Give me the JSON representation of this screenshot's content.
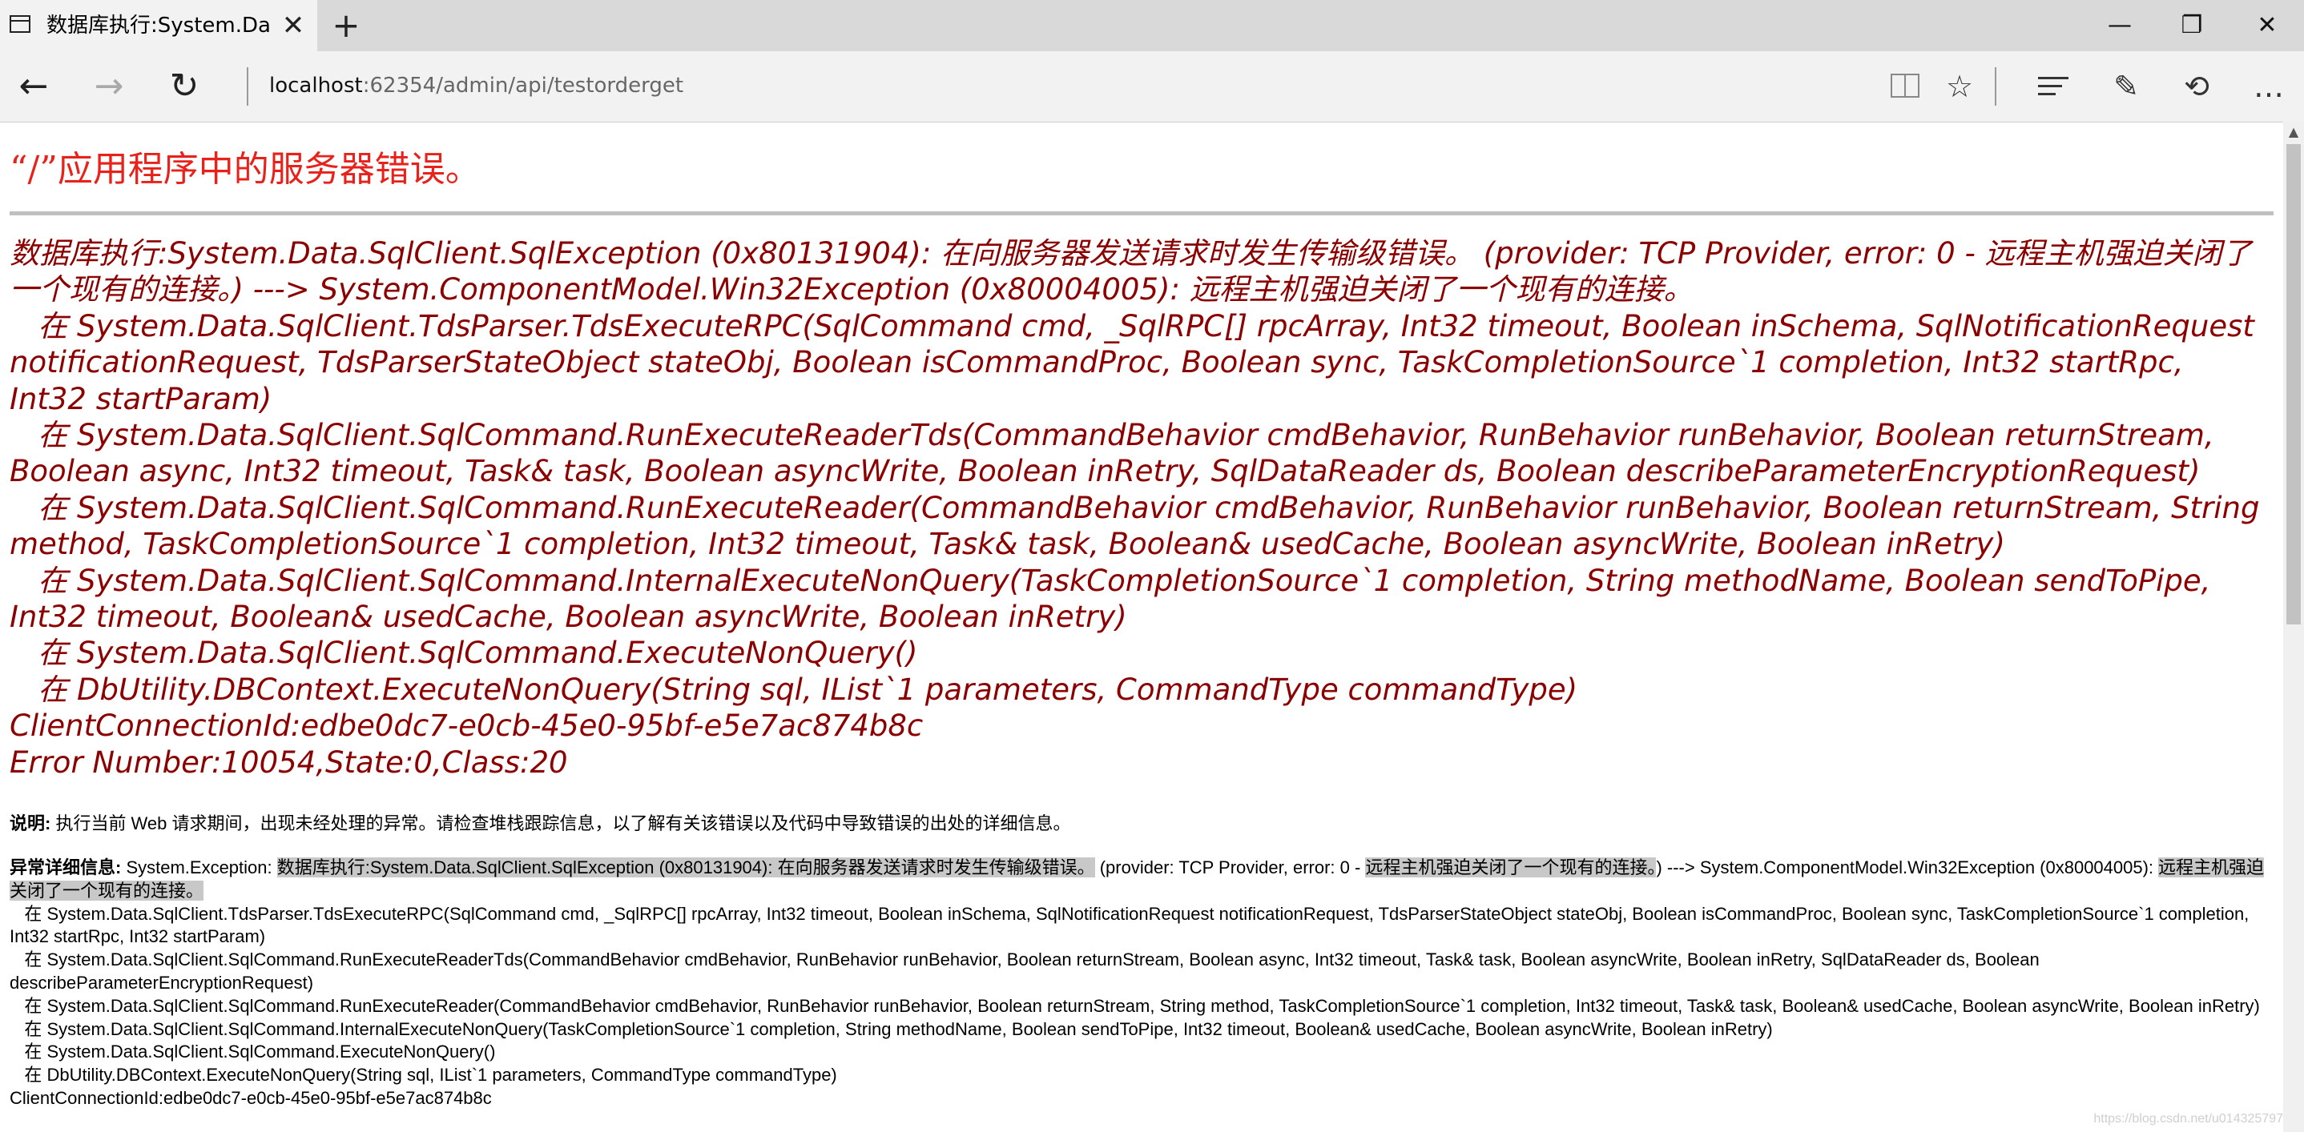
{
  "browser": {
    "tab_title": "数据库执行:System.Data",
    "tab_close": "✕",
    "new_tab": "+",
    "window": {
      "minimize": "—",
      "maximize": "❐",
      "close": "✕"
    },
    "address": {
      "host": "localhost",
      "rest": ":62354/admin/api/testorderget"
    },
    "nav": {
      "back": "←",
      "forward": "→",
      "refresh": "↻"
    },
    "tools": {
      "favorite": "☆",
      "share": "⟲",
      "more": "…",
      "note": "✎"
    }
  },
  "page": {
    "heading": "“/”应用程序中的服务器错误。",
    "error_message": "数据库执行:System.Data.SqlClient.SqlException (0x80131904): 在向服务器发送请求时发生传输级错误。 (provider: TCP Provider, error: 0 - 远程主机强迫关闭了一个现有的连接。) ---> System.ComponentModel.Win32Exception (0x80004005): 远程主机强迫关闭了一个现有的连接。\n   在 System.Data.SqlClient.TdsParser.TdsExecuteRPC(SqlCommand cmd, _SqlRPC[] rpcArray, Int32 timeout, Boolean inSchema, SqlNotificationRequest notificationRequest, TdsParserStateObject stateObj, Boolean isCommandProc, Boolean sync, TaskCompletionSource`1 completion, Int32 startRpc, Int32 startParam)\n   在 System.Data.SqlClient.SqlCommand.RunExecuteReaderTds(CommandBehavior cmdBehavior, RunBehavior runBehavior, Boolean returnStream, Boolean async, Int32 timeout, Task& task, Boolean asyncWrite, Boolean inRetry, SqlDataReader ds, Boolean describeParameterEncryptionRequest)\n   在 System.Data.SqlClient.SqlCommand.RunExecuteReader(CommandBehavior cmdBehavior, RunBehavior runBehavior, Boolean returnStream, String method, TaskCompletionSource`1 completion, Int32 timeout, Task& task, Boolean& usedCache, Boolean asyncWrite, Boolean inRetry)\n   在 System.Data.SqlClient.SqlCommand.InternalExecuteNonQuery(TaskCompletionSource`1 completion, String methodName, Boolean sendToPipe, Int32 timeout, Boolean& usedCache, Boolean asyncWrite, Boolean inRetry)\n   在 System.Data.SqlClient.SqlCommand.ExecuteNonQuery()\n   在 DbUtility.DBContext.ExecuteNonQuery(String sql, IList`1 parameters, CommandType commandType)\nClientConnectionId:edbe0dc7-e0cb-45e0-95bf-e5e7ac874b8c\nError Number:10054,State:0,Class:20",
    "description_label": "说明:",
    "description_text": " 执行当前 Web 请求期间，出现未经处理的异常。请检查堆栈跟踪信息，以了解有关该错误以及代码中导致错误的出处的详细信息。",
    "detail_label": "异常详细信息:",
    "detail_prefix": " System.Exception: ",
    "detail_highlight_1": "数据库执行:System.Data.SqlClient.SqlException (0x80131904): 在向服务器发送请求时发生传输级错误。",
    "detail_mid": " (provider: TCP Provider, error: 0 - ",
    "detail_highlight_2": "远程主机强迫关闭了一个现有的连接。",
    "detail_mid2": ") ---> System.ComponentModel.Win32Exception (0x80004005): ",
    "detail_highlight_3": "远程主机强迫关闭了一个现有的连接。",
    "detail_stack": "\n   在 System.Data.SqlClient.TdsParser.TdsExecuteRPC(SqlCommand cmd, _SqlRPC[] rpcArray, Int32 timeout, Boolean inSchema, SqlNotificationRequest notificationRequest, TdsParserStateObject stateObj, Boolean isCommandProc, Boolean sync, TaskCompletionSource`1 completion, Int32 startRpc, Int32 startParam)\n   在 System.Data.SqlClient.SqlCommand.RunExecuteReaderTds(CommandBehavior cmdBehavior, RunBehavior runBehavior, Boolean returnStream, Boolean async, Int32 timeout, Task& task, Boolean asyncWrite, Boolean inRetry, SqlDataReader ds, Boolean describeParameterEncryptionRequest)\n   在 System.Data.SqlClient.SqlCommand.RunExecuteReader(CommandBehavior cmdBehavior, RunBehavior runBehavior, Boolean returnStream, String method, TaskCompletionSource`1 completion, Int32 timeout, Task& task, Boolean& usedCache, Boolean asyncWrite, Boolean inRetry)\n   在 System.Data.SqlClient.SqlCommand.InternalExecuteNonQuery(TaskCompletionSource`1 completion, String methodName, Boolean sendToPipe, Int32 timeout, Boolean& usedCache, Boolean asyncWrite, Boolean inRetry)\n   在 System.Data.SqlClient.SqlCommand.ExecuteNonQuery()\n   在 DbUtility.DBContext.ExecuteNonQuery(String sql, IList`1 parameters, CommandType commandType)\nClientConnectionId:edbe0dc7-e0cb-45e0-95bf-e5e7ac874b8c",
    "watermark": "https://blog.csdn.net/u014325797"
  },
  "colors": {
    "heading": "#e8221a",
    "error_text": "#8b0000",
    "titlebar": "#d9d9d9",
    "navbar": "#f2f2f2"
  }
}
